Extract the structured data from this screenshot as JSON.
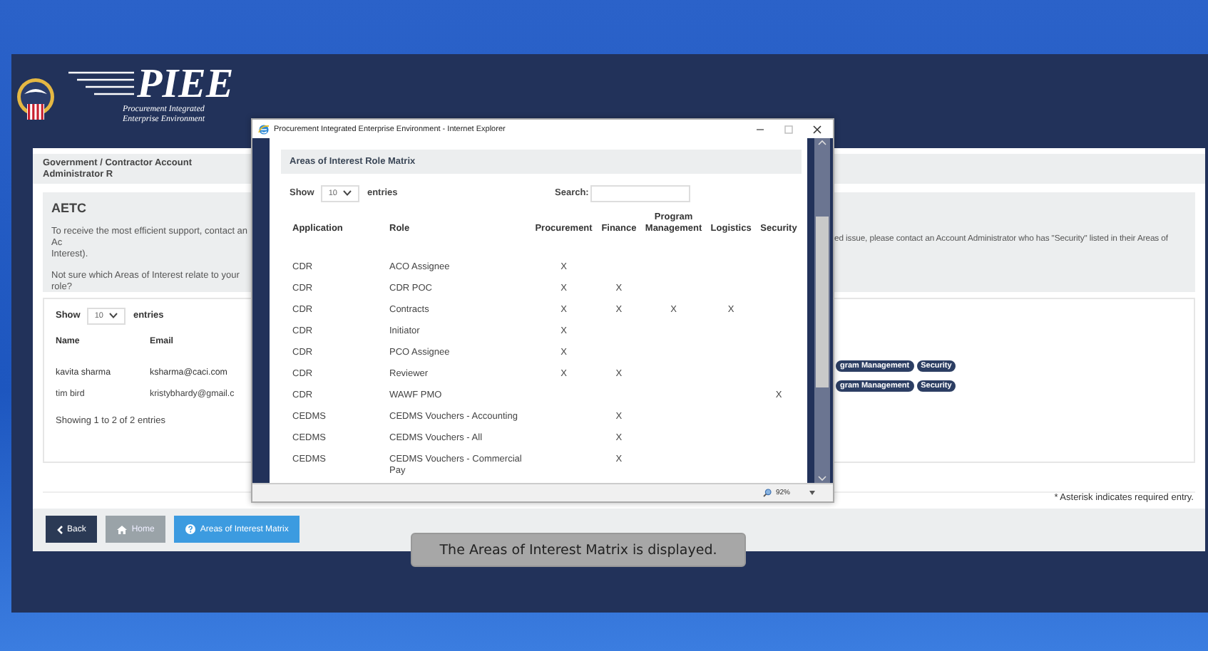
{
  "header": {
    "logo_title": "PIEE",
    "logo_subtitle_lines": [
      "Procurement Integrated",
      "Enterprise Environment"
    ]
  },
  "page": {
    "title": "Government / Contractor Account Administrator R",
    "notice": {
      "heading": "AETC",
      "left_lines": [
        "To receive the most efficient support, contact an Ac",
        "Interest).",
        "Not sure which Areas of Interest relate to your role?"
      ],
      "right_line": "ed issue, please contact an Account Administrator who has \"Security\" listed in their Areas of"
    },
    "table": {
      "show_label": "Show",
      "page_size": "10",
      "entries_label": "entries",
      "columns": [
        "Name",
        "Email"
      ],
      "rows": [
        {
          "name": "kavita sharma",
          "email": "ksharma@caci.com",
          "badges": [
            "gram Management",
            "Security"
          ]
        },
        {
          "name": "tim bird",
          "email": "kristybhardy@gmail.c",
          "badges": [
            "gram Management",
            "Security"
          ]
        }
      ],
      "info": "Showing 1 to 2 of 2 entries"
    },
    "footnote": "* Asterisk indicates required entry.",
    "buttons": [
      {
        "label": "Back",
        "kind": "dark"
      },
      {
        "label": "Home",
        "kind": "muted"
      },
      {
        "label": "Areas of Interest Matrix",
        "kind": "info"
      }
    ]
  },
  "popup": {
    "title": "Procurement Integrated Enterprise Environment - Internet Explorer",
    "panel_title": "Areas of Interest Role Matrix",
    "show_label": "Show",
    "page_size": "10",
    "entries_label": "entries",
    "search_label": "Search:",
    "columns": [
      "Application",
      "Role",
      "Procurement",
      "Finance",
      "Program Management",
      "Logistics",
      "Security"
    ],
    "rows": [
      [
        "CDR",
        "ACO Assignee",
        "X",
        null,
        null,
        null,
        null
      ],
      [
        "CDR",
        "CDR POC",
        "X",
        "X",
        null,
        null,
        null
      ],
      [
        "CDR",
        "Contracts",
        "X",
        "X",
        "X",
        "X",
        null
      ],
      [
        "CDR",
        "Initiator",
        "X",
        null,
        null,
        null,
        null
      ],
      [
        "CDR",
        "PCO Assignee",
        "X",
        null,
        null,
        null,
        null
      ],
      [
        "CDR",
        "Reviewer",
        "X",
        "X",
        null,
        null,
        null
      ],
      [
        "CDR",
        "WAWF PMO",
        null,
        null,
        null,
        null,
        "X"
      ],
      [
        "CEDMS",
        "CEDMS Vouchers - Accounting",
        null,
        "X",
        null,
        null,
        null
      ],
      [
        "CEDMS",
        "CEDMS Vouchers - All",
        null,
        "X",
        null,
        null,
        null
      ],
      [
        "CEDMS",
        "CEDMS Vouchers - Commercial Pay",
        null,
        "X",
        null,
        null,
        null
      ]
    ],
    "zoom": "92%"
  },
  "caption": "The Areas of Interest Matrix is displayed."
}
